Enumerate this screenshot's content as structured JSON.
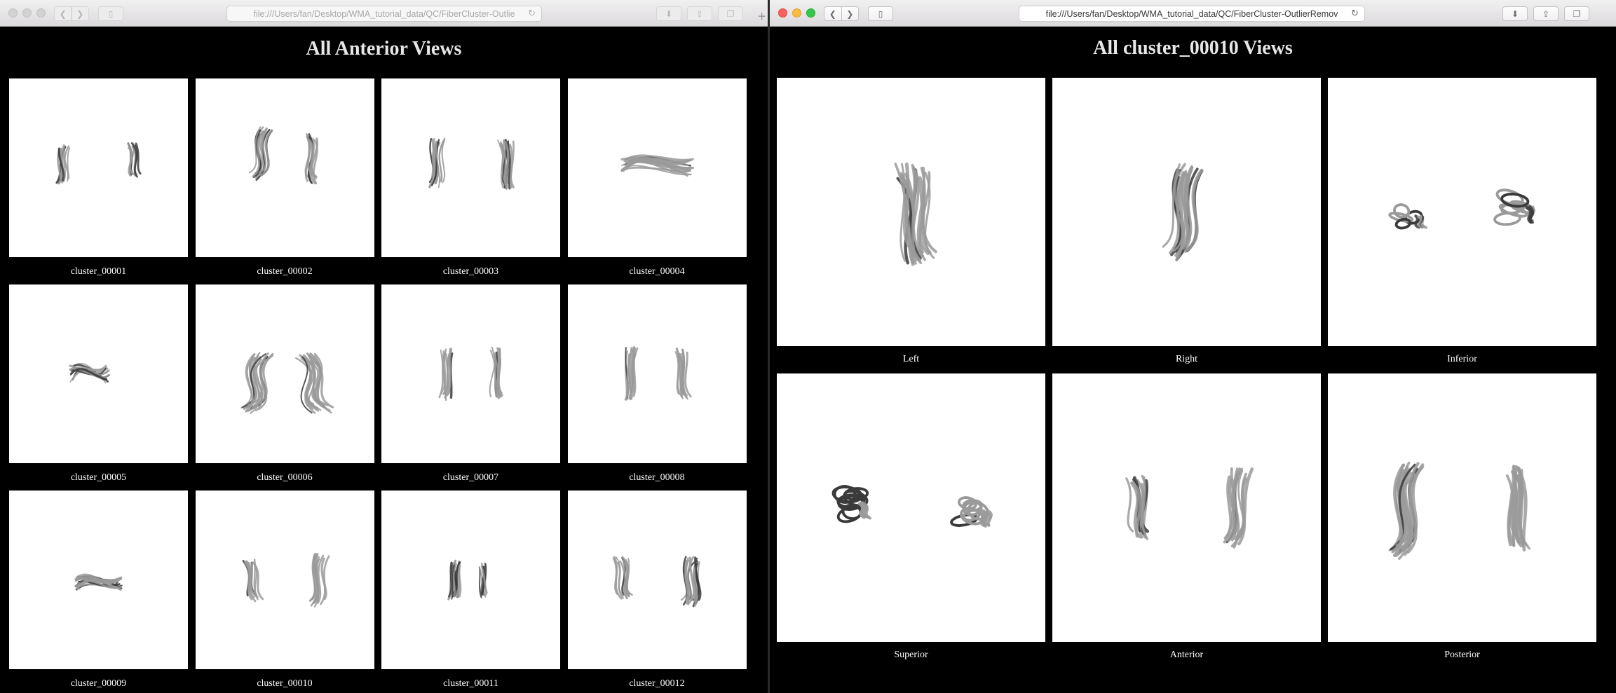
{
  "left_window": {
    "url": "file:///Users/fan/Desktop/WMA_tutorial_data/QC/FiberCluster-Outlie",
    "title": "All Anterior Views",
    "tiles": [
      {
        "label": "cluster_00001",
        "shape": "pair-small"
      },
      {
        "label": "cluster_00002",
        "shape": "pair-wedge"
      },
      {
        "label": "cluster_00003",
        "shape": "pair-mid"
      },
      {
        "label": "cluster_00004",
        "shape": "bridge"
      },
      {
        "label": "cluster_00005",
        "shape": "knot"
      },
      {
        "label": "cluster_00006",
        "shape": "arch"
      },
      {
        "label": "cluster_00007",
        "shape": "pair-vertical"
      },
      {
        "label": "cluster_00008",
        "shape": "pair-vertical"
      },
      {
        "label": "cluster_00009",
        "shape": "dense-horizontal"
      },
      {
        "label": "cluster_00010",
        "shape": "pair-curve"
      },
      {
        "label": "cluster_00011",
        "shape": "pair-close"
      },
      {
        "label": "cluster_00012",
        "shape": "pair-spread"
      }
    ]
  },
  "right_window": {
    "url": "file:///Users/fan/Desktop/WMA_tutorial_data/QC/FiberCluster-OutlierRemov",
    "title": "All cluster_00010 Views",
    "tiles": [
      {
        "label": "Left",
        "shape": "single-tall"
      },
      {
        "label": "Right",
        "shape": "single-tall-2"
      },
      {
        "label": "Inferior",
        "shape": "pair-loops"
      },
      {
        "label": "Superior",
        "shape": "pair-loops-dark"
      },
      {
        "label": "Anterior",
        "shape": "pair-curve"
      },
      {
        "label": "Posterior",
        "shape": "pair-big"
      }
    ]
  },
  "colors": {
    "page_bg": "#000000",
    "tile_bg": "#ffffff",
    "title": "#e7e7e7",
    "fiber_light": "#9a9a9a",
    "fiber_dark": "#3a3a3a"
  },
  "icons": [
    "back-icon",
    "forward-icon",
    "sidebar-icon",
    "download-icon",
    "share-icon",
    "tabs-icon",
    "reload-icon",
    "new-tab-icon"
  ]
}
